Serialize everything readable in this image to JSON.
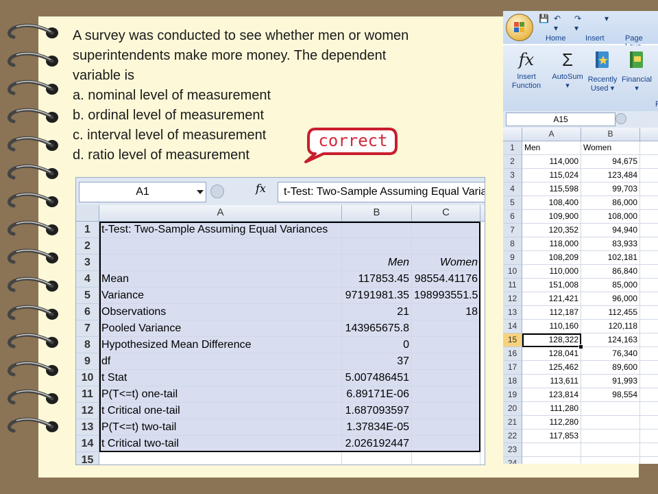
{
  "question": {
    "text_line1": "A survey was conducted to see whether men or women",
    "text_line2": "superintendents make more money.  The dependent",
    "text_line3": "variable is",
    "options": [
      "a.  nominal level of measurement",
      "b.  ordinal level of measurement",
      "c.  interval level of measurement",
      "d.  ratio level of measurement"
    ]
  },
  "answer_bubble": {
    "label": "correct",
    "color": "#d4283a"
  },
  "analysis_sheet": {
    "name_box": "A1",
    "fx": "fx",
    "formula": "t-Test: Two-Sample Assuming Equal Variances",
    "columns": [
      "A",
      "B",
      "C"
    ],
    "rows": [
      {
        "num": "1",
        "a": "t-Test: Two-Sample Assuming Equal Variances",
        "b": "",
        "c": ""
      },
      {
        "num": "2",
        "a": "",
        "b": "",
        "c": ""
      },
      {
        "num": "3",
        "a": "",
        "b": "Men",
        "c": "Women"
      },
      {
        "num": "4",
        "a": "Mean",
        "b": "117853.45",
        "c": "98554.41176"
      },
      {
        "num": "5",
        "a": "Variance",
        "b": "97191981.35",
        "c": "198993551.5"
      },
      {
        "num": "6",
        "a": "Observations",
        "b": "21",
        "c": "18"
      },
      {
        "num": "7",
        "a": "Pooled Variance",
        "b": "143965675.8",
        "c": ""
      },
      {
        "num": "8",
        "a": "Hypothesized Mean Difference",
        "b": "0",
        "c": ""
      },
      {
        "num": "9",
        "a": "df",
        "b": "37",
        "c": ""
      },
      {
        "num": "10",
        "a": "t Stat",
        "b": "5.007486451",
        "c": ""
      },
      {
        "num": "11",
        "a": "P(T<=t) one-tail",
        "b": "6.89171E-06",
        "c": ""
      },
      {
        "num": "12",
        "a": "t Critical one-tail",
        "b": "1.687093597",
        "c": ""
      },
      {
        "num": "13",
        "a": "P(T<=t) two-tail",
        "b": "1.37834E-05",
        "c": ""
      },
      {
        "num": "14",
        "a": "t Critical two-tail",
        "b": "2.026192447",
        "c": ""
      },
      {
        "num": "15",
        "a": "",
        "b": "",
        "c": ""
      }
    ]
  },
  "data_sheet": {
    "quick_access": {
      "save": "💾",
      "undo": "↶ ▾",
      "redo": "↷ ▾",
      "customize": "▾"
    },
    "tabs": [
      "Home",
      "Insert",
      "Page Layo"
    ],
    "ribbon_buttons": [
      {
        "label_1": "Insert",
        "label_2": "Function",
        "icon": "fx-icon"
      },
      {
        "label_1": "AutoSum",
        "label_2": "▾",
        "icon": "sigma-icon"
      },
      {
        "label_1": "Recently",
        "label_2": "Used ▾",
        "icon": "book-star-icon"
      },
      {
        "label_1": "Financial",
        "label_2": "▾",
        "icon": "book-money-icon"
      },
      {
        "label_1": "L",
        "label_2": "",
        "icon": "book-icon"
      }
    ],
    "ribbon_group_label": "F",
    "name_box": "A15",
    "columns": [
      "A",
      "B"
    ],
    "rows": [
      {
        "num": "1",
        "a": "Men",
        "b": "Women"
      },
      {
        "num": "2",
        "a": "114,000",
        "b": "94,675"
      },
      {
        "num": "3",
        "a": "115,024",
        "b": "123,484"
      },
      {
        "num": "4",
        "a": "115,598",
        "b": "99,703"
      },
      {
        "num": "5",
        "a": "108,400",
        "b": "86,000"
      },
      {
        "num": "6",
        "a": "109,900",
        "b": "108,000"
      },
      {
        "num": "7",
        "a": "120,352",
        "b": "94,940"
      },
      {
        "num": "8",
        "a": "118,000",
        "b": "83,933"
      },
      {
        "num": "9",
        "a": "108,209",
        "b": "102,181"
      },
      {
        "num": "10",
        "a": "110,000",
        "b": "86,840"
      },
      {
        "num": "11",
        "a": "151,008",
        "b": "85,000"
      },
      {
        "num": "12",
        "a": "121,421",
        "b": "96,000"
      },
      {
        "num": "13",
        "a": "112,187",
        "b": "112,455"
      },
      {
        "num": "14",
        "a": "110,160",
        "b": "120,118"
      },
      {
        "num": "15",
        "a": "128,322",
        "b": "124,163"
      },
      {
        "num": "16",
        "a": "128,041",
        "b": "76,340"
      },
      {
        "num": "17",
        "a": "125,462",
        "b": "89,600"
      },
      {
        "num": "18",
        "a": "113,611",
        "b": "91,993"
      },
      {
        "num": "19",
        "a": "123,814",
        "b": "98,554"
      },
      {
        "num": "20",
        "a": "111,280",
        "b": ""
      },
      {
        "num": "21",
        "a": "112,280",
        "b": ""
      },
      {
        "num": "22",
        "a": "117,853",
        "b": ""
      },
      {
        "num": "23",
        "a": "",
        "b": ""
      },
      {
        "num": "24",
        "a": "",
        "b": ""
      }
    ]
  }
}
